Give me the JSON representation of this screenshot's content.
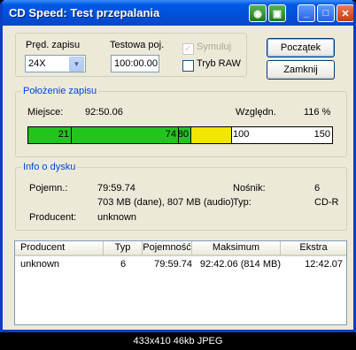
{
  "window": {
    "title": "CD Speed: Test przepalania",
    "titlebar_buttons": [
      "minimize-icon",
      "maximize-icon",
      "close-icon"
    ],
    "app_icons": [
      "cd-icon",
      "save-icon"
    ]
  },
  "settings": {
    "speed_label": "Pręd. zapisu",
    "speed_value": "24X",
    "test_pos_label": "Testowa poj.",
    "test_pos_value": "100:00.00",
    "simulate_label": "Symuluj",
    "simulate_checked": true,
    "raw_mode_label": "Tryb RAW",
    "raw_mode_checked": false,
    "start_button": "Początek",
    "close_button": "Zamknij"
  },
  "write_position": {
    "group_label": "Położenie zapisu",
    "place_label": "Miejsce:",
    "place_value": "92:50.06",
    "relative_label": "Względn.",
    "relative_value": "116 %",
    "bar": {
      "max": 150,
      "marks": [
        "21",
        "74",
        "80",
        "100",
        "150"
      ],
      "green_end": 80,
      "yellow_end": 100,
      "colors": {
        "green": "#22C51E",
        "yellow": "#F2E600",
        "white": "#FFFFFF"
      }
    }
  },
  "disc_info": {
    "group_label": "Info o dysku",
    "capacity_label": "Pojemn.:",
    "capacity_value": "79:59.74",
    "capacity_detail": "703 MB (dane), 807 MB (audio)",
    "manufacturer_label": "Producent:",
    "manufacturer_value": "unknown",
    "media_label": "Nośnik:",
    "media_value": "6",
    "type_label": "Typ:",
    "type_value": "CD-R"
  },
  "table": {
    "columns": [
      "Producent",
      "Typ",
      "Pojemność",
      "Maksimum",
      "Ekstra"
    ],
    "rows": [
      [
        "unknown",
        "6",
        "79:59.74",
        "92:42.06 (814 MB)",
        "12:42.07"
      ]
    ]
  },
  "statusbar": {
    "text": "433x410 46kb JPEG"
  }
}
